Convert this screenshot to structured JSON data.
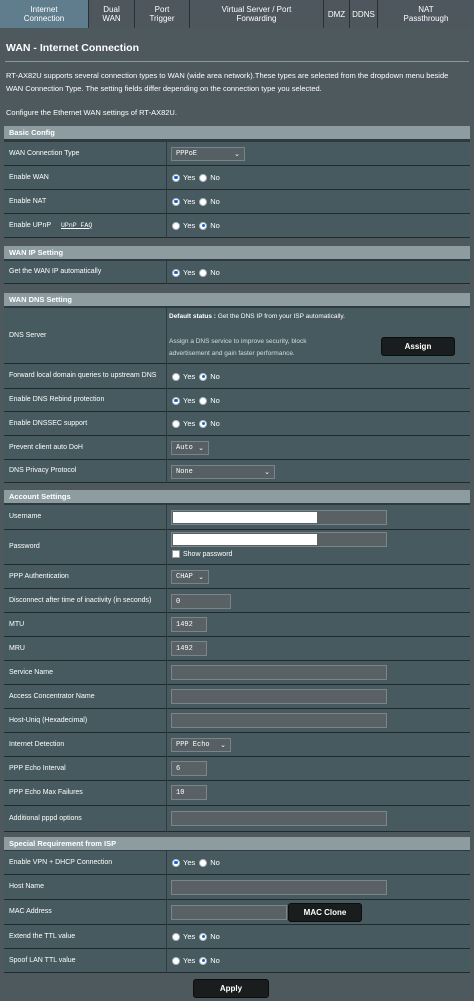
{
  "tabs": [
    {
      "l1": "Internet",
      "l2": "Connection"
    },
    {
      "l1": "Dual",
      "l2": "WAN"
    },
    {
      "l1": "Port",
      "l2": "Trigger"
    },
    {
      "l1": "Virtual Server / Port",
      "l2": "Forwarding"
    },
    {
      "l1": "DMZ",
      "l2": ""
    },
    {
      "l1": "DDNS",
      "l2": ""
    },
    {
      "l1": "NAT",
      "l2": "Passthrough"
    }
  ],
  "page": {
    "title": "WAN - Internet Connection",
    "description": "RT-AX82U supports several connection types to WAN (wide area network).These types are selected from the dropdown menu beside WAN Connection Type. The setting fields differ depending on the connection type you selected.",
    "configure": "Configure the Ethernet WAN settings of RT-AX82U."
  },
  "radio": {
    "yes": "Yes",
    "no": "No"
  },
  "basic": {
    "header": "Basic Config",
    "wan_type_label": "WAN Connection Type",
    "wan_type_value": "PPPoE",
    "enable_wan_label": "Enable WAN",
    "enable_nat_label": "Enable NAT",
    "enable_upnp_label": "Enable UPnP",
    "upnp_faq": "UPnP  FAQ"
  },
  "wanip": {
    "header": "WAN IP Setting",
    "auto_ip_label": "Get the WAN IP automatically"
  },
  "dns": {
    "header": "WAN DNS Setting",
    "server_label": "DNS Server",
    "default_status_bold": "Default status :",
    "default_status_text": " Get the DNS IP from your ISP automatically.",
    "assign_hint_1": "Assign a DNS service to improve security, block",
    "assign_hint_2": "advertisement and gain faster performance.",
    "assign_button": "Assign",
    "forward_label": "Forward local domain queries to upstream DNS",
    "rebind_label": "Enable DNS Rebind protection",
    "dnssec_label": "Enable DNSSEC support",
    "doh_label": "Prevent client auto DoH",
    "doh_value": "Auto",
    "privacy_label": "DNS Privacy Protocol",
    "privacy_value": "None"
  },
  "account": {
    "header": "Account Settings",
    "username_label": "Username",
    "password_label": "Password",
    "show_password": "Show password",
    "auth_label": "PPP Authentication",
    "auth_value": "CHAP",
    "idle_label": "Disconnect after time of inactivity (in seconds)",
    "idle_value": "0",
    "mtu_label": "MTU",
    "mtu_value": "1492",
    "mru_label": "MRU",
    "mru_value": "1492",
    "service_label": "Service Name",
    "ac_label": "Access Concentrator Name",
    "hostuniq_label": "Host-Uniq (Hexadecimal)",
    "detect_label": "Internet Detection",
    "detect_value": "PPP Echo",
    "echo_interval_label": "PPP Echo Interval",
    "echo_interval_value": "6",
    "echo_fail_label": "PPP Echo Max Failures",
    "echo_fail_value": "10",
    "pppd_label": "Additional pppd options"
  },
  "isp": {
    "header": "Special Requirement from ISP",
    "vpn_label": "Enable VPN + DHCP Connection",
    "host_label": "Host Name",
    "mac_label": "MAC Address",
    "mac_clone": "MAC Clone",
    "ttl_label": "Extend the TTL value",
    "spoof_label": "Spoof LAN TTL value"
  },
  "apply": "Apply",
  "colors": {
    "accent_blue": "#1a64d6",
    "section_header": "#8c9ca1",
    "active_tab": "#5f7d8c"
  }
}
